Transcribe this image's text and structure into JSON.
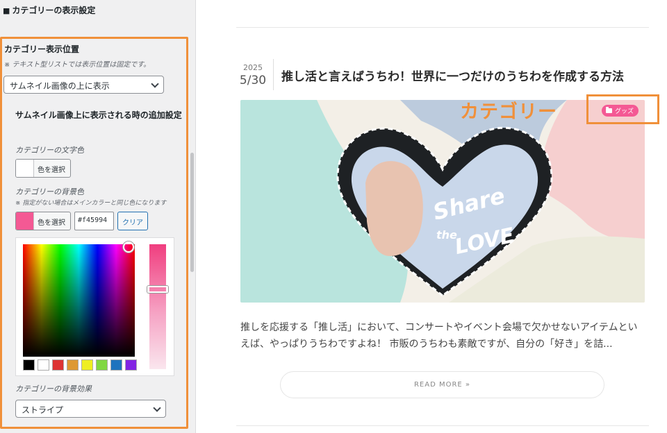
{
  "panel": {
    "section_title": "カテゴリーの表示設定",
    "position_label": "カテゴリー表示位置",
    "position_note": "※ テキスト型リストでは表示位置は固定です。",
    "position_value": "サムネイル画像の上に表示",
    "extra_heading": "サムネイル画像上に表示される時の追加設定",
    "text_color_label": "カテゴリーの文字色",
    "select_color": "色を選択",
    "bg_color_label": "カテゴリーの背景色",
    "bg_color_note": "※ 指定がない場合はメインカラーと同じ色になります",
    "bg_color_hex": "#f45994",
    "clear": "クリア",
    "effect_label": "カテゴリーの背景効果",
    "effect_value": "ストライプ",
    "palette": [
      "#000000",
      "#ffffff",
      "#dd3333",
      "#dd9933",
      "#eeee22",
      "#81d742",
      "#1e73be",
      "#8224e3"
    ],
    "colors": {
      "text_swatch": "#ffffff",
      "bg_swatch": "#f45994",
      "highlight": "#f0903a"
    }
  },
  "post": {
    "year": "2025",
    "date": "5/30",
    "title": "推し活と言えばうちわ！世界に一つだけのうちわを作成する方法",
    "category": "グッズ",
    "annotation": "カテゴリー",
    "thumbnail_text": [
      "Share",
      "the",
      "LOVE"
    ],
    "excerpt": "推しを応援する「推し活」において、コンサートやイベント会場で欠かせないアイテムといえば、やっぱりうちわですよね！ 市販のうちわも素敵ですが、自分の「好き」を詰...",
    "read_more": "READ MORE »"
  }
}
